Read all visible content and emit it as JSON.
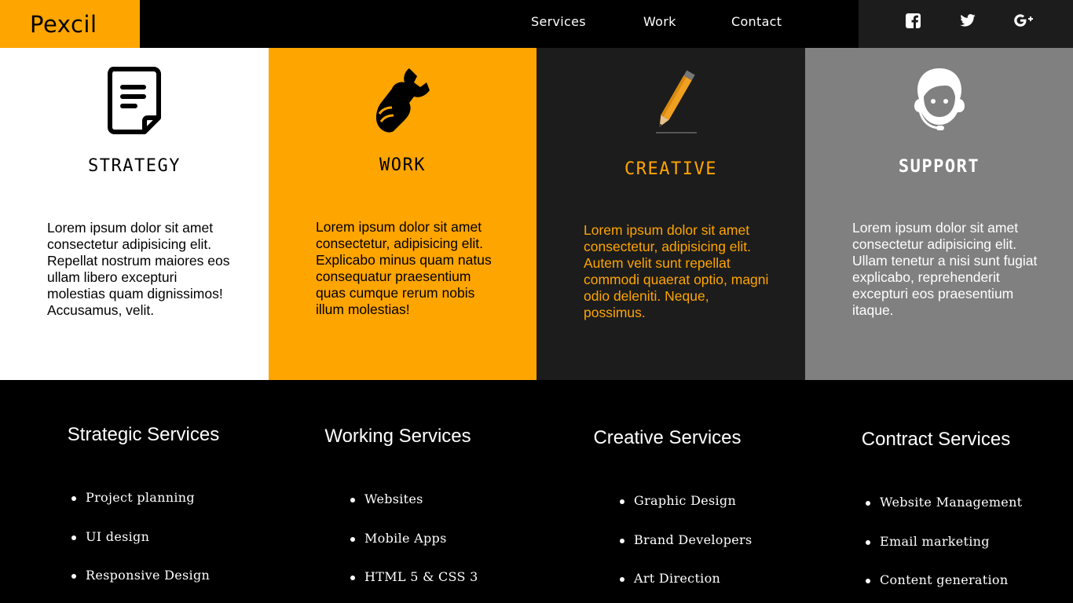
{
  "header": {
    "logo": "Pexcil",
    "nav": [
      {
        "label": "Services"
      },
      {
        "label": "Work"
      },
      {
        "label": "Contact"
      }
    ],
    "social": [
      {
        "icon": "facebook-icon"
      },
      {
        "icon": "twitter-icon"
      },
      {
        "icon": "google-plus-icon"
      }
    ]
  },
  "features": [
    {
      "icon": "document-icon",
      "title": "STRATEGY",
      "text": "Lorem ipsum dolor sit amet consectetur adipisicing elit. Repellat nostrum maiores eos ullam libero excepturi molestias quam dignissimos! Accusamus, velit.",
      "bg": "#FFFFFF",
      "color": "#000000"
    },
    {
      "icon": "wrench-hand-icon",
      "title": "WORK",
      "text": "Lorem ipsum dolor sit amet consectetur, adipisicing elit. Explicabo minus quam natus consequatur praesentium quas cumque rerum nobis illum molestias!",
      "bg": "#FFA500",
      "color": "#000000"
    },
    {
      "icon": "pencil-icon",
      "title": "CREATIVE",
      "text": "Lorem ipsum dolor sit amet consectetur, adipisicing elit. Autem velit sunt repellat commodi quaerat optio, magni odio deleniti. Neque, possimus.",
      "bg": "#1C1C1C",
      "color": "#FFA500"
    },
    {
      "icon": "headset-support-icon",
      "title": "SUPPORT",
      "text": "Lorem ipsum dolor sit amet consectetur adipisicing elit. Ullam tenetur a nisi sunt fugiat explicabo, reprehenderit excepturi eos praesentium itaque.",
      "bg": "#808080",
      "color": "#FFFFFF"
    }
  ],
  "services": [
    {
      "title": "Strategic Services",
      "items": [
        "Project planning",
        "UI design",
        "Responsive Design"
      ]
    },
    {
      "title": "Working Services",
      "items": [
        "Websites",
        "Mobile Apps",
        "HTML 5 & CSS 3"
      ]
    },
    {
      "title": "Creative Services",
      "items": [
        "Graphic Design",
        "Brand Developers",
        "Art Direction"
      ]
    },
    {
      "title": "Contract Services",
      "items": [
        "Website Management",
        "Email marketing",
        "Content generation"
      ]
    }
  ]
}
